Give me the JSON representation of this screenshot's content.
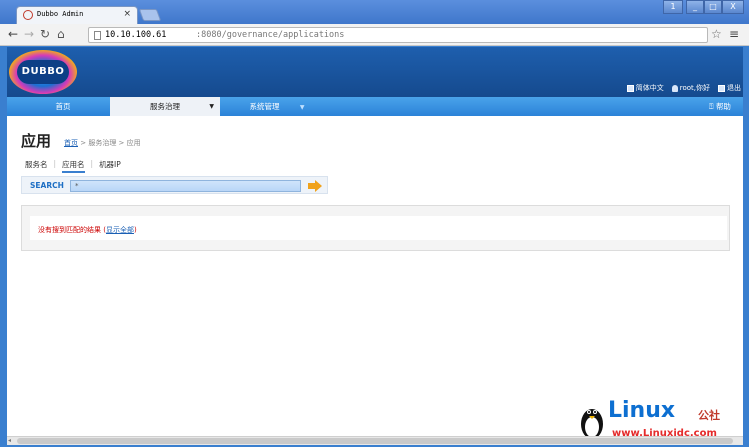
{
  "browser": {
    "tab_title": "Dubbo Admin",
    "tab_close": "×",
    "url_host": "10.10.100.61",
    "url_path": ":8080/governance/applications",
    "window_buttons": {
      "user": "1",
      "minimize": "_",
      "maximize": "□",
      "close": "X"
    }
  },
  "header": {
    "logo_text": "DUBBO",
    "links": [
      {
        "label": "简体中文",
        "icon": "doc-icon"
      },
      {
        "label": "root,你好",
        "icon": "user-icon"
      },
      {
        "label": "退出",
        "icon": "exit-icon"
      }
    ]
  },
  "nav": {
    "home": "首页",
    "service": "服务治理",
    "system": "系统管理",
    "help": "帮助"
  },
  "page": {
    "title": "应用",
    "breadcrumb": {
      "home": "首页",
      "rest": " > 服务治理 > 应用"
    },
    "tabs": [
      "服务名",
      "应用名",
      "机器IP"
    ],
    "search_label": "SEARCH",
    "search_value": "*",
    "result_message": "没有搜到匹配的结果",
    "result_open": " (",
    "result_link": "显示全部",
    "result_close": ")"
  },
  "watermark": {
    "title": "Linux",
    "cn": "公社",
    "url": "www.Linuxidc.com"
  }
}
